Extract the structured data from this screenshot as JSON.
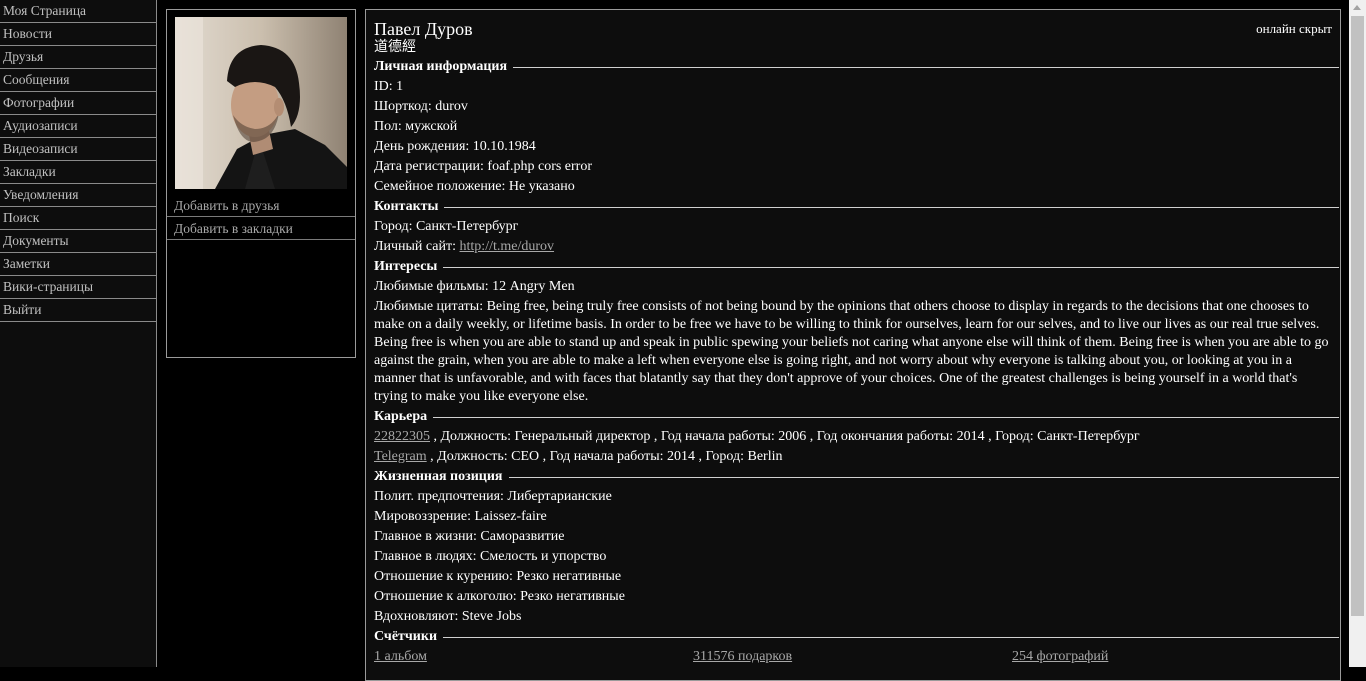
{
  "nav": {
    "items": [
      {
        "label": "Моя Страница"
      },
      {
        "label": "Новости"
      },
      {
        "label": "Друзья"
      },
      {
        "label": "Сообщения"
      },
      {
        "label": "Фотографии"
      },
      {
        "label": "Аудиозаписи"
      },
      {
        "label": "Видеозаписи"
      },
      {
        "label": "Закладки"
      },
      {
        "label": "Уведомления"
      },
      {
        "label": "Поиск"
      },
      {
        "label": "Документы"
      },
      {
        "label": "Заметки"
      },
      {
        "label": "Вики-страницы"
      },
      {
        "label": "Выйти"
      }
    ]
  },
  "avatar": {
    "add_friend": "Добавить в друзья",
    "add_bookmark": "Добавить в закладки"
  },
  "profile": {
    "name": "Павел Дуров",
    "status": "道德經",
    "online": "онлайн скрыт",
    "sections": {
      "personal": "Личная информация",
      "contacts": "Контакты",
      "interests": "Интересы",
      "career": "Карьера",
      "life": "Жизненная позиция",
      "counters": "Счётчики"
    },
    "personal": {
      "id": "ID: 1",
      "shortcode": "Шорткод: durov",
      "gender": "Пол: мужской",
      "birthday": "День рождения: 10.10.1984",
      "registration": "Дата регистрации: foaf.php cors error",
      "relationship": "Семейное положение: Не указано"
    },
    "contacts": {
      "city": "Город: Санкт-Петербург",
      "site_label": "Личный сайт: ",
      "site_link": "http://t.me/durov"
    },
    "interests": {
      "movies": "Любимые фильмы: 12 Angry Men",
      "quotes": "Любимые цитаты: Being free, being truly free consists of not being bound by the opinions that others choose to display in regards to the decisions that one chooses to make on a daily weekly, or lifetime basis. In order to be free we have to be willing to think for ourselves, learn for our selves, and to live our lives as our real true selves. Being free is when you are able to stand up and speak in public spewing your beliefs not caring what anyone else will think of them. Being free is when you are able to go against the grain, when you are able to make a left when everyone else is going right, and not worry about why everyone is talking about you, or looking at you in a manner that is unfavorable, and with faces that blatantly say that they don't approve of your choices. One of the greatest challenges is being yourself in a world that's trying to make you like everyone else."
    },
    "career": [
      {
        "link": "22822305",
        "details": " , Должность: Генеральный директор , Год начала работы: 2006 , Год окончания работы: 2014 , Город: Санкт-Петербург"
      },
      {
        "link": "Telegram",
        "details": " , Должность: CEO , Год начала работы: 2014 , Город: Berlin"
      }
    ],
    "life": {
      "politics": "Полит. предпочтения: Либертарианские",
      "worldview": "Мировоззрение: Laissez-faire",
      "life_main": "Главное в жизни: Саморазвитие",
      "people_main": "Главное в людях: Смелость и упорство",
      "smoking": "Отношение к курению: Резко негативные",
      "alcohol": "Отношение к алкоголю: Резко негативные",
      "inspired": "Вдохновляют: Steve Jobs"
    },
    "counters": {
      "albums": "1 альбом",
      "gifts": "311576 подарков",
      "photos": "254 фотографий"
    }
  }
}
